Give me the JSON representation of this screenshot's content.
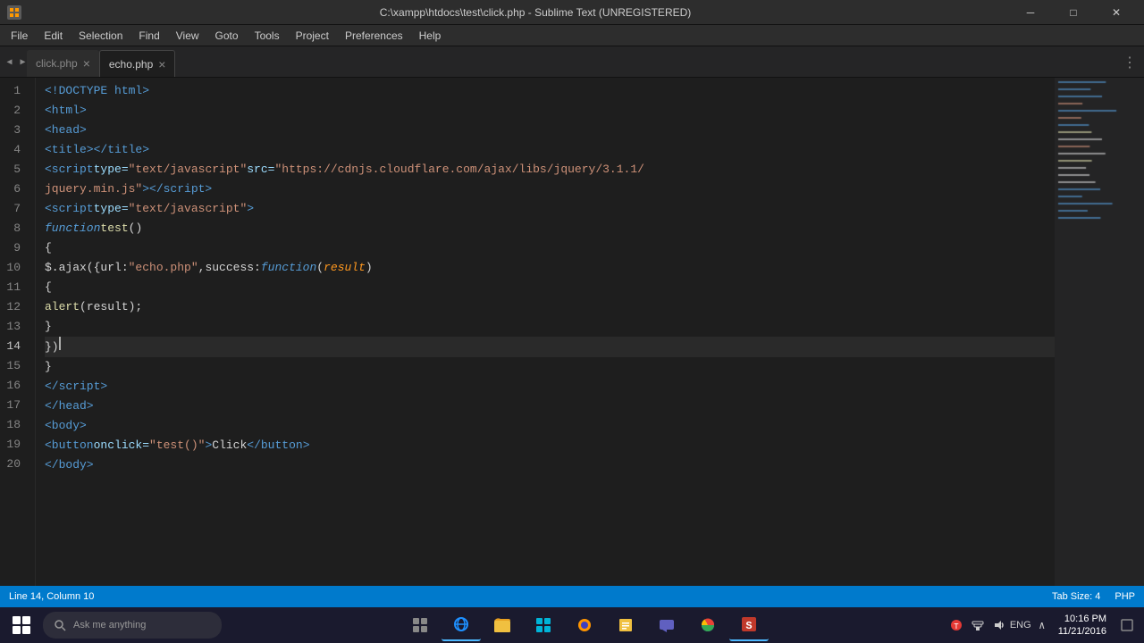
{
  "titleBar": {
    "title": "C:\\xampp\\htdocs\\test\\click.php - Sublime Text (UNREGISTERED)",
    "minimize": "─",
    "maximize": "□",
    "close": "✕"
  },
  "menuBar": {
    "items": [
      "File",
      "Edit",
      "Selection",
      "Find",
      "View",
      "Goto",
      "Tools",
      "Project",
      "Preferences",
      "Help"
    ]
  },
  "tabs": [
    {
      "label": "click.php",
      "active": false
    },
    {
      "label": "echo.php",
      "active": true
    }
  ],
  "lineNumbers": [
    1,
    2,
    3,
    4,
    5,
    6,
    7,
    8,
    9,
    10,
    11,
    12,
    13,
    14,
    15,
    16,
    17,
    18,
    19,
    20
  ],
  "currentLine": 14,
  "statusBar": {
    "lineCol": "Line 14, Column 10",
    "tabSize": "Tab Size: 4",
    "syntax": "PHP"
  },
  "taskbar": {
    "searchPlaceholder": "Ask me anything",
    "clock": "10:16 PM",
    "date": "11/21/2016"
  }
}
